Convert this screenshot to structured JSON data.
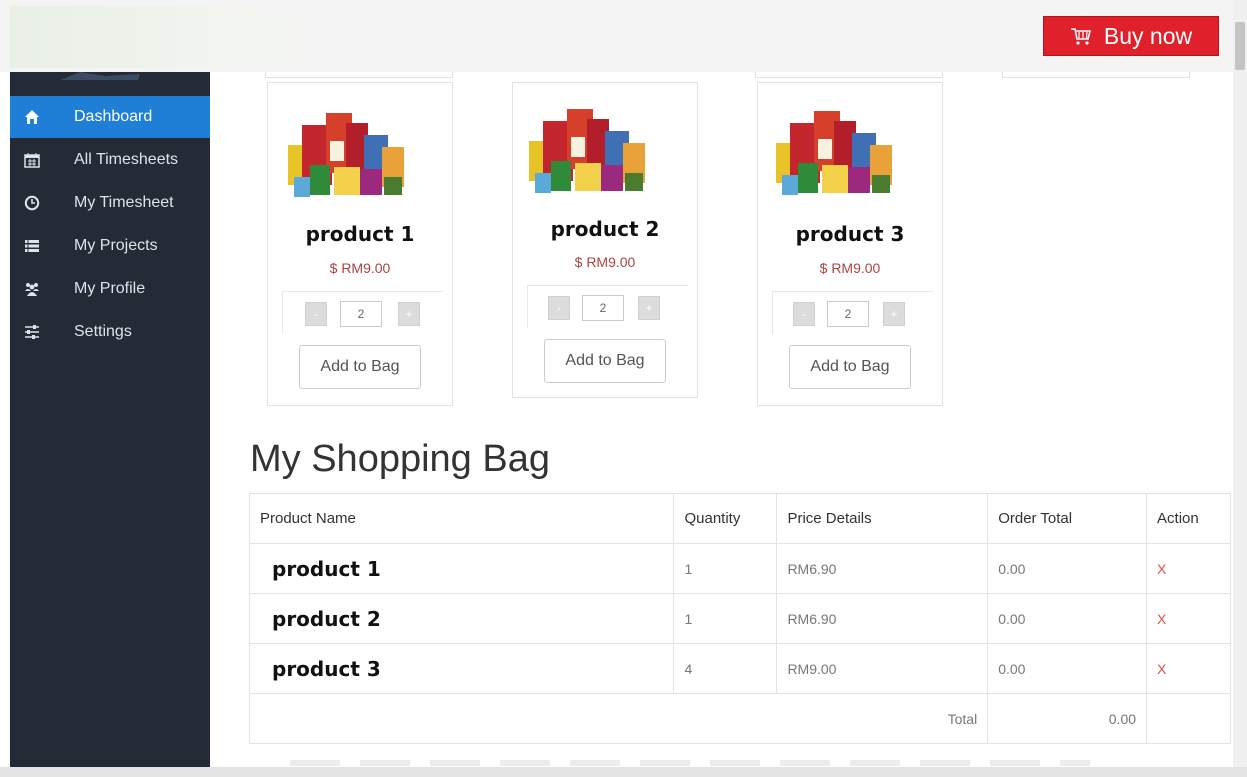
{
  "header": {
    "buy_label": "Buy now"
  },
  "sidebar": {
    "items": [
      {
        "label": "Dashboard",
        "icon": "home-icon",
        "active": true
      },
      {
        "label": "All Timesheets",
        "icon": "calendar-icon"
      },
      {
        "label": "My Timesheet",
        "icon": "clock-icon"
      },
      {
        "label": "My Projects",
        "icon": "list-icon"
      },
      {
        "label": "My Profile",
        "icon": "users-icon"
      },
      {
        "label": "Settings",
        "icon": "sliders-icon"
      }
    ]
  },
  "products": [
    {
      "name": "product 1",
      "price": "$ RM9.00",
      "qty": "2",
      "minus": "-",
      "plus": "+",
      "add_label": "Add to Bag"
    },
    {
      "name": "product 2",
      "price": "$ RM9.00",
      "qty": "2",
      "minus": "-",
      "plus": "+",
      "add_label": "Add to Bag"
    },
    {
      "name": "product 3",
      "price": "$ RM9.00",
      "qty": "2",
      "minus": "-",
      "plus": "+",
      "add_label": "Add to Bag"
    }
  ],
  "bag": {
    "title": "My Shopping Bag",
    "headers": [
      "Product Name",
      "Quantity",
      "Price Details",
      "Order Total",
      "Action"
    ],
    "rows": [
      {
        "name": "product 1",
        "qty": "1",
        "price": "RM6.90",
        "total": "0.00",
        "action": "X"
      },
      {
        "name": "product 2",
        "qty": "1",
        "price": "RM6.90",
        "total": "0.00",
        "action": "X"
      },
      {
        "name": "product 3",
        "qty": "4",
        "price": "RM9.00",
        "total": "0.00",
        "action": "X"
      }
    ],
    "total_label": "Total",
    "total_value": "0.00"
  },
  "colors": {
    "accent": "#1f7fd6",
    "buy": "#e0202a",
    "sidebar": "#252b36",
    "price": "#a94442"
  }
}
